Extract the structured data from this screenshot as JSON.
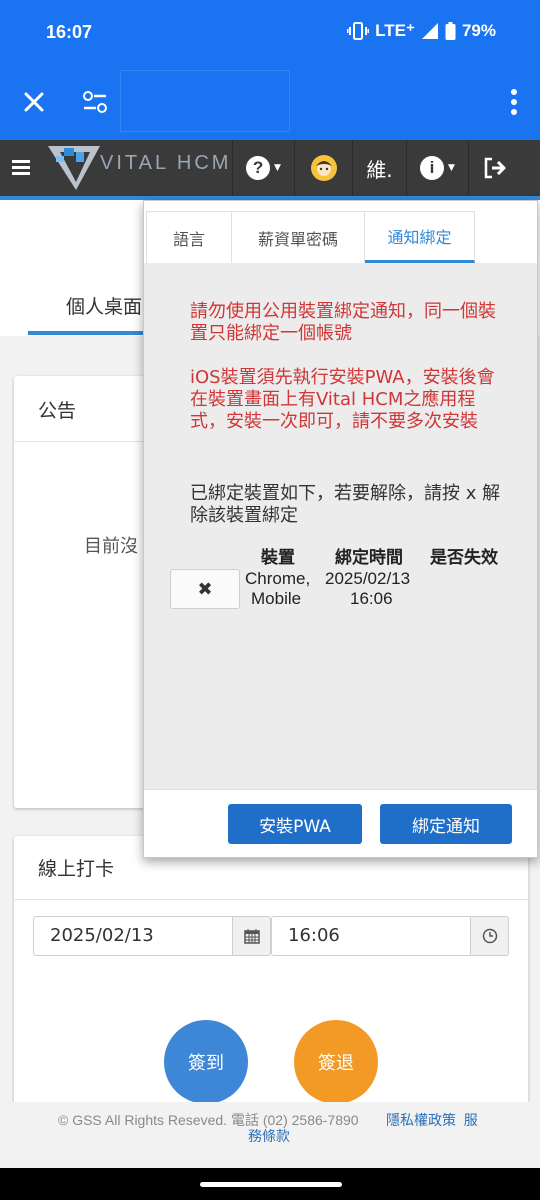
{
  "status_bar": {
    "time": "16:07",
    "network": "LTE⁺",
    "battery": "79%"
  },
  "browser": {
    "close_icon": "close-icon",
    "settings_icon": "tune-icon",
    "menu_icon": "more-vert-icon"
  },
  "app_header": {
    "logo_text": "VITAL HCM",
    "user_label": "維.",
    "colors": {
      "background": "#3a3a3a",
      "accent": "#2f8ad8"
    }
  },
  "page": {
    "tab_personal": "個人桌面",
    "announcement": {
      "title": "公告",
      "empty_text": "目前沒"
    },
    "checkin": {
      "title": "線上打卡",
      "date": "2025/02/13",
      "time": "16:06",
      "sign_in": "簽到",
      "sign_out": "簽退"
    },
    "footer": {
      "copyright": "© GSS All Rights Reseved. 電話 (02) 2586-7890",
      "privacy": "隱私權政策",
      "terms_1": "服",
      "terms_2": "務條款"
    }
  },
  "popup": {
    "tabs": [
      "語言",
      "薪資單密碼",
      "通知綁定"
    ],
    "active_tab": "通知綁定",
    "warning_1": "請勿使用公用裝置綁定通知，同一個裝置只能綁定一個帳號",
    "warning_2": "iOS裝置須先執行安裝PWA，安裝後會在裝置畫面上有Vital HCM之應用程式，安裝一次即可，請不要多次安裝",
    "note": "已綁定裝置如下，若要解除，請按 x 解除該裝置綁定",
    "table_headers": [
      "裝置",
      "綁定時間",
      "是否失效"
    ],
    "rows": [
      {
        "device_1": "Chrome,",
        "device_2": "Mobile",
        "date": "2025/02/13",
        "time": "16:06",
        "unbind_label": "✖"
      }
    ],
    "buttons": {
      "install_pwa": "安裝PWA",
      "bind": "綁定通知"
    }
  }
}
